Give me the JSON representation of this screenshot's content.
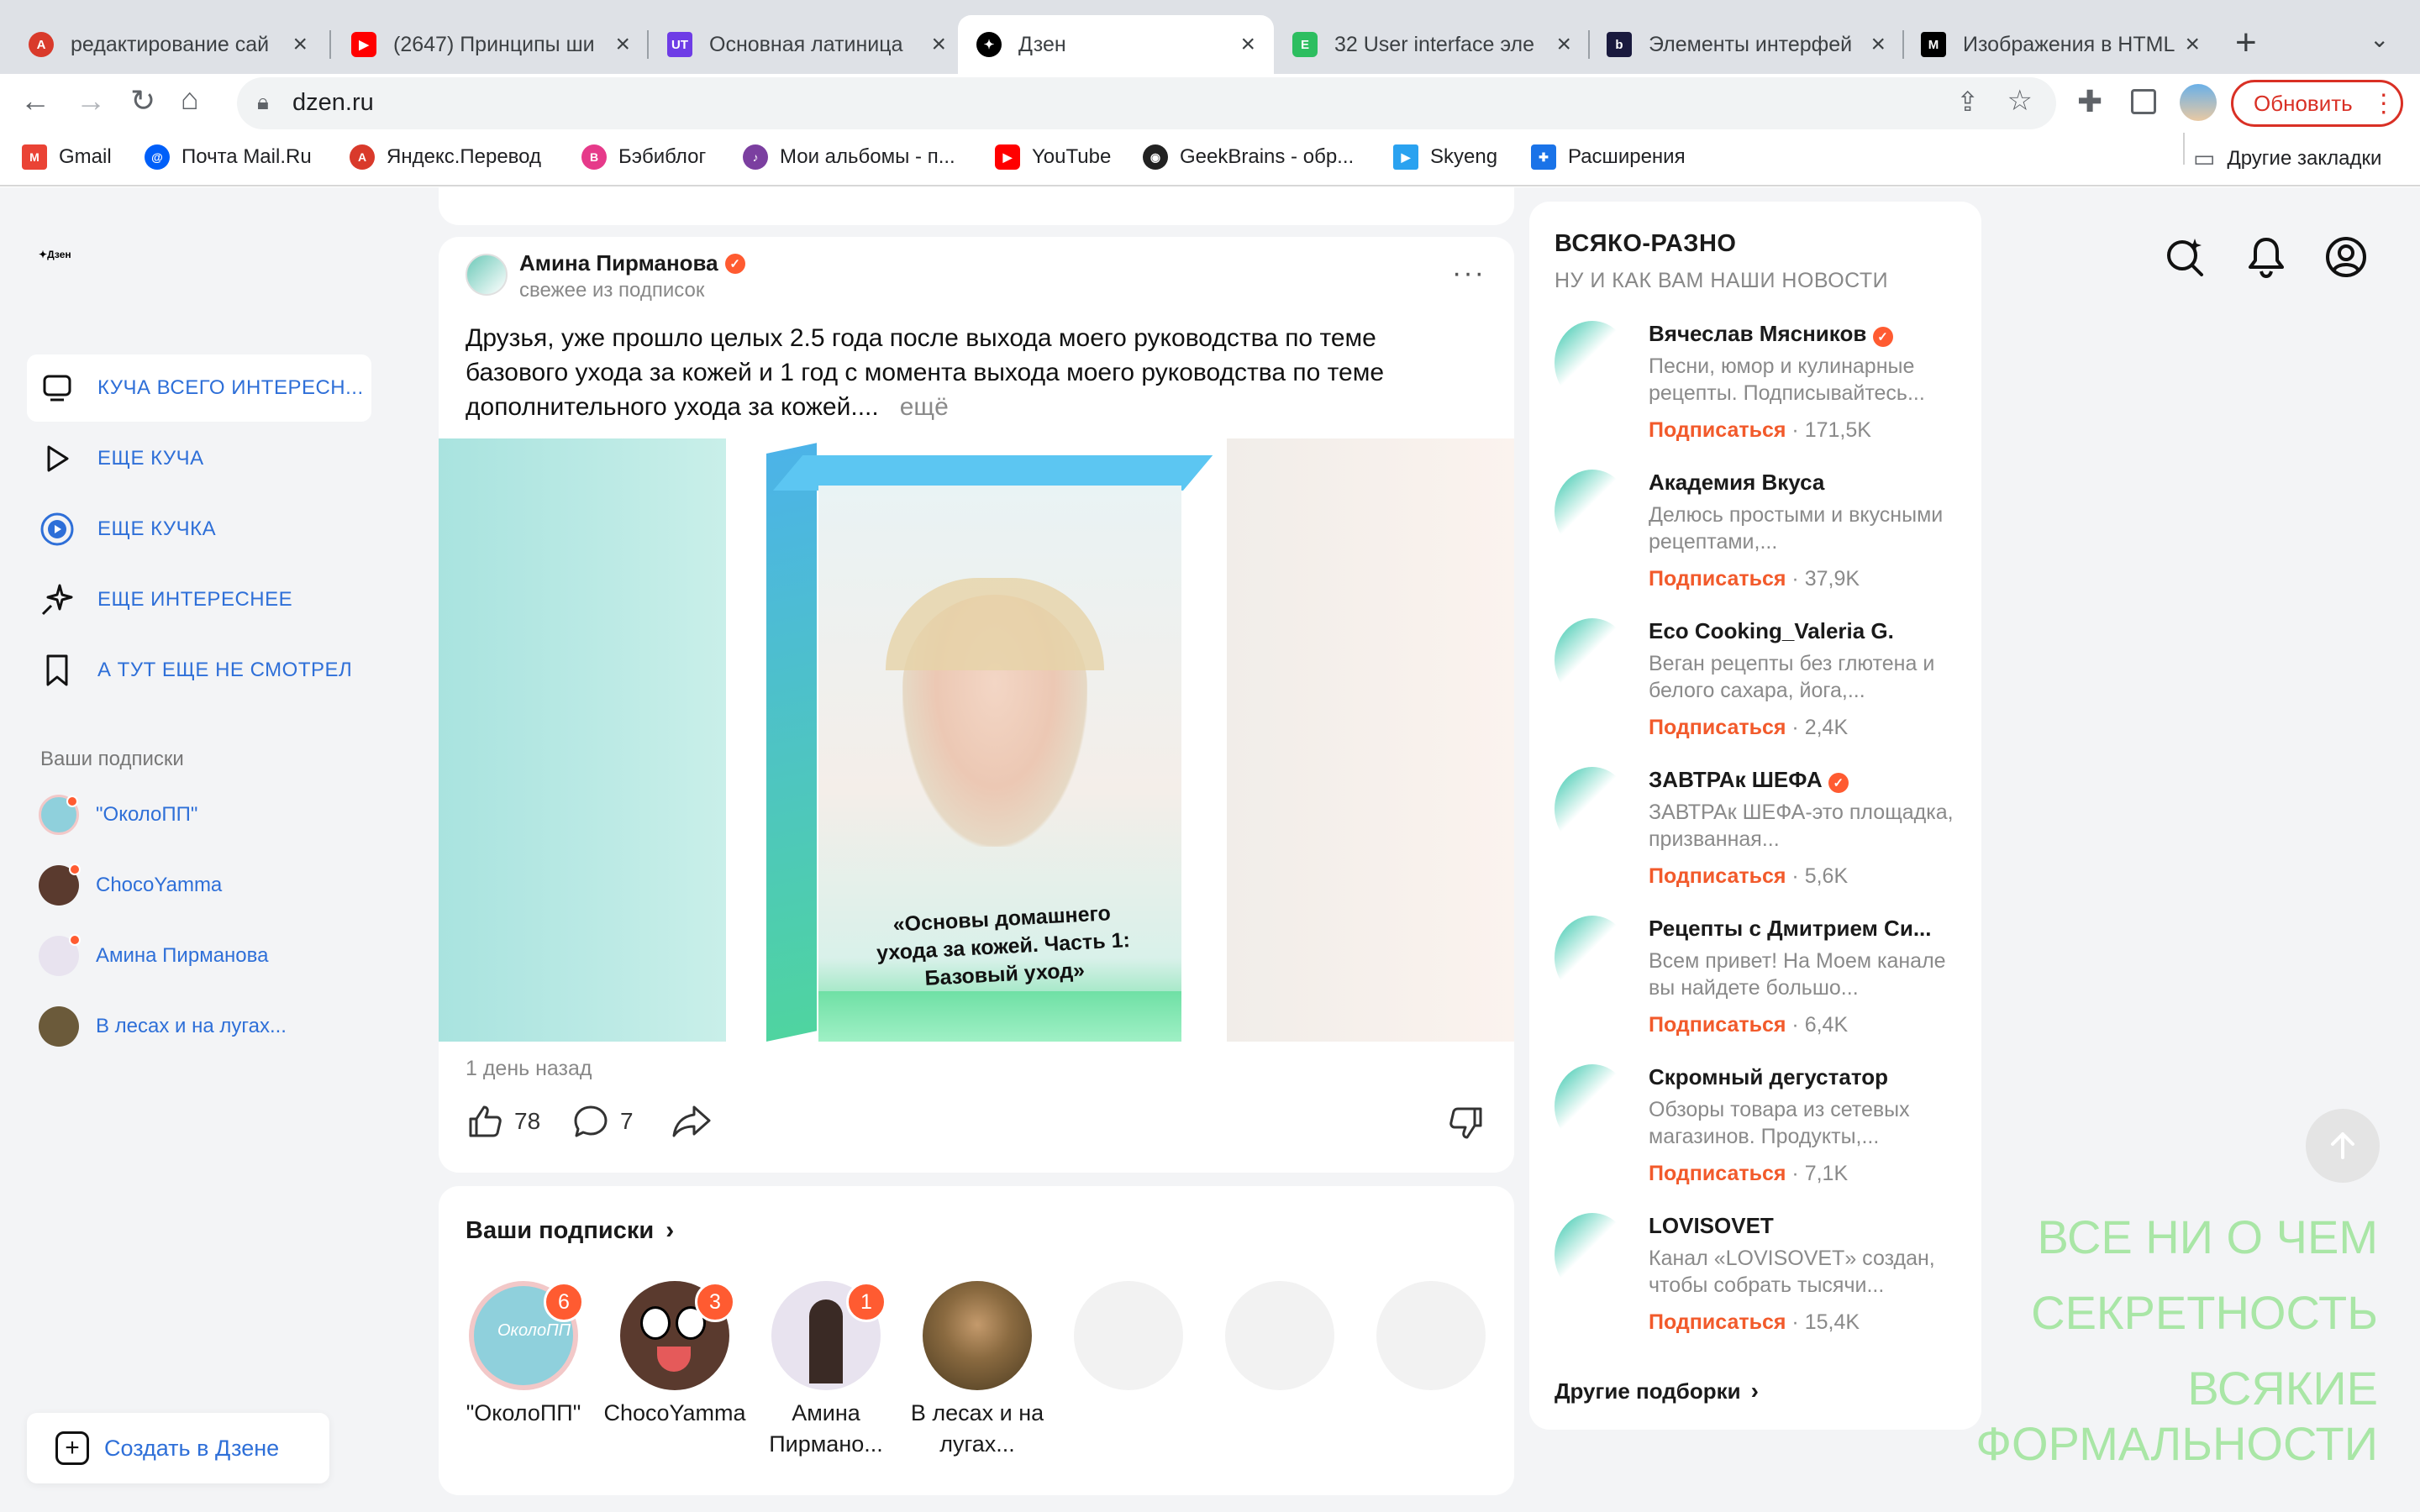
{
  "browser": {
    "tabs": [
      {
        "title": "редактирование сай",
        "favicon": "ab-icon",
        "color": "#d93a2b"
      },
      {
        "title": "(2647) Принципы ши",
        "favicon": "youtube-icon",
        "color": "#ff0000"
      },
      {
        "title": "Основная латиница",
        "favicon": "ut-icon",
        "color": "#6e3ce6"
      },
      {
        "title": "Дзен",
        "favicon": "dzen-icon",
        "color": "#000000",
        "active": true
      },
      {
        "title": "32 User interface эле",
        "favicon": "evernote-icon",
        "color": "#2dbe60"
      },
      {
        "title": "Элементы интерфей",
        "favicon": "b-icon",
        "color": "#1a1a3e"
      },
      {
        "title": "Изображения в HTML",
        "favicon": "m-icon",
        "color": "#000000"
      }
    ],
    "url": "dzen.ru",
    "update_label": "Обновить",
    "bookmarks": [
      {
        "label": "Gmail",
        "icon": "gmail-icon",
        "color": "#ea4335"
      },
      {
        "label": "Почта Mail.Ru",
        "icon": "mailru-icon",
        "color": "#005ff9"
      },
      {
        "label": "Яндекс.Перевод",
        "icon": "translate-icon",
        "color": "#d93a2b"
      },
      {
        "label": "Бэбиблог",
        "icon": "babyblog-icon",
        "color": "#e63a8a"
      },
      {
        "label": "Мои альбомы - п...",
        "icon": "albums-icon",
        "color": "#7b3fa0"
      },
      {
        "label": "YouTube",
        "icon": "youtube-icon",
        "color": "#ff0000"
      },
      {
        "label": "GeekBrains - обр...",
        "icon": "geekbrains-icon",
        "color": "#222222"
      },
      {
        "label": "Skyeng",
        "icon": "skyeng-icon",
        "color": "#2aa2f0"
      },
      {
        "label": "Расширения",
        "icon": "puzzle-icon",
        "color": "#1a73e8"
      }
    ],
    "other_bookmarks": "Другие закладки"
  },
  "sidebar": {
    "logo": "Дзен",
    "nav": [
      {
        "label": "КУЧА ВСЕГО ИНТЕРЕСН...",
        "icon": "tv-icon",
        "selected": true
      },
      {
        "label": "ЕЩЕ КУЧА",
        "icon": "play-icon"
      },
      {
        "label": "ЕЩЕ КУЧКА",
        "icon": "video-icon"
      },
      {
        "label": "ЕЩЕ ИНТЕРЕСНЕЕ",
        "icon": "sparkle-icon"
      },
      {
        "label": "А ТУТ ЕЩЕ НЕ СМОТРЕЛ",
        "icon": "bookmark-icon"
      }
    ],
    "subs_title": "Ваши подписки",
    "subs": [
      {
        "label": "\"ОколоПП\""
      },
      {
        "label": "ChocoYamma"
      },
      {
        "label": "Амина Пирманова"
      },
      {
        "label": "В лесах и на лугах..."
      }
    ],
    "create_label": "Создать в Дзене"
  },
  "post": {
    "author": "Амина Пирманова",
    "source": "свежее из подписок",
    "text": "Друзья, уже прошло целых 2.5 года после выхода моего руководства по теме базового ухода за кожей и 1 год с момента выхода моего руководства по теме дополнительного ухода за кожей....",
    "more": "ещё",
    "image_caption": "«Основы домашнего ухода за кожей. Часть 1: Базовый уход»",
    "time": "1 день назад",
    "likes": "78",
    "comments": "7"
  },
  "stories": {
    "title": "Ваши подписки",
    "items": [
      {
        "label": "\"ОколоПП\"",
        "badge": "6",
        "color": "#8fd0dc"
      },
      {
        "label": "ChocoYamma",
        "badge": "3",
        "color": "#5a3a2e"
      },
      {
        "label": "Амина Пирмано...",
        "badge": "1",
        "color": "#e8e3ef"
      },
      {
        "label": "В лесах и на лугах...",
        "badge": "",
        "color": "#6b5a3a"
      }
    ]
  },
  "recs": {
    "title": "ВСЯКО-РАЗНО",
    "subtitle": "НУ И КАК ВАМ НАШИ НОВОСТИ",
    "subscribe": "Подписаться",
    "items": [
      {
        "name": "Вячеслав Мясников",
        "verified": true,
        "desc": "Песни, юмор и кулинарные рецепты. Подписывайтесь...",
        "count": "171,5K"
      },
      {
        "name": "Академия Вкуса",
        "verified": false,
        "desc": "Делюсь простыми и вкусными рецептами,...",
        "count": "37,9K"
      },
      {
        "name": "Eco Cooking_Valeria G.",
        "verified": false,
        "desc": "Веган рецепты без глютена и белого сахара, йога,...",
        "count": "2,4K"
      },
      {
        "name": "ЗАВТРАк ШЕФА",
        "verified": true,
        "desc": "ЗАВТРАк ШЕФА-это площадка, призванная...",
        "count": "5,6K"
      },
      {
        "name": "Рецепты с Дмитрием Си...",
        "verified": false,
        "desc": "Всем привет! На Моем канале вы найдете большо...",
        "count": "6,4K"
      },
      {
        "name": "Скромный дегустатор",
        "verified": false,
        "desc": "Обзоры товара из сетевых магазинов. Продукты,...",
        "count": "7,1K"
      },
      {
        "name": "LOVISOVET",
        "verified": false,
        "desc": "Канал «LOVISOVET» создан, чтобы собрать тысячи...",
        "count": "15,4K"
      }
    ],
    "more_label": "Другие подборки"
  },
  "promo": {
    "line1": "ВСЕ НИ О ЧЕМ",
    "line2": "СЕКРЕТНОСТЬ",
    "line3": "ВСЯКИЕ ФОРМАЛЬНОСТИ"
  },
  "colors": {
    "accent": "#2e6fd8",
    "orange": "#f25a2b",
    "promo_green": "#a9e6a6"
  }
}
